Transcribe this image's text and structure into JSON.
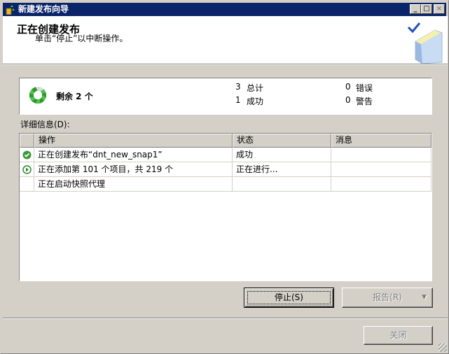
{
  "window": {
    "title": "新建发布向导"
  },
  "header": {
    "title": "正在创建发布",
    "subtitle": "单击“停止”以中断操作。"
  },
  "summary": {
    "remaining": "剩余 2 个",
    "total_count": "3",
    "total_label": "总计",
    "success_count": "1",
    "success_label": "成功",
    "error_count": "0",
    "error_label": "错误",
    "warning_count": "0",
    "warning_label": "警告",
    "progress_fraction": 0.33
  },
  "details": {
    "label": "详细信息(D):",
    "columns": [
      "操作",
      "状态",
      "消息"
    ],
    "rows": [
      {
        "icon": "success-icon",
        "action": "正在创建发布“dnt_new_snap1”",
        "status": "成功",
        "message": ""
      },
      {
        "icon": "in-progress-icon",
        "action": "正在添加第 101 个项目，共 219 个",
        "status": "正在进行...",
        "message": ""
      },
      {
        "icon": "",
        "action": "正在启动快照代理",
        "status": "",
        "message": ""
      }
    ]
  },
  "buttons": {
    "stop": "停止(S)",
    "report": "报告(R)",
    "close": "关闭"
  },
  "colors": {
    "titlebar": "#0a246a",
    "success": "#3a9a3a"
  }
}
